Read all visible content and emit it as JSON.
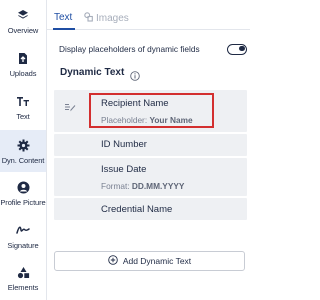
{
  "sidebar": {
    "items": [
      {
        "label": "Overview",
        "icon": "layers-icon"
      },
      {
        "label": "Uploads",
        "icon": "upload-icon"
      },
      {
        "label": "Text",
        "icon": "text-icon"
      },
      {
        "label": "Dyn. Content",
        "icon": "gear-icon",
        "active": true
      },
      {
        "label": "Profile Picture",
        "icon": "profile-icon"
      },
      {
        "label": "Signature",
        "icon": "signature-icon"
      },
      {
        "label": "Elements",
        "icon": "shapes-icon"
      }
    ]
  },
  "tabs": [
    {
      "label": "Text",
      "active": true
    },
    {
      "label": "Images",
      "active": false,
      "icon": "images-icon"
    }
  ],
  "settings": {
    "placeholder_toggle_label": "Display placeholders of dynamic fields",
    "placeholder_toggle_on": true
  },
  "dynamic_text": {
    "title": "Dynamic Text",
    "fields": [
      {
        "name": "Recipient Name",
        "sub_prefix": "Placeholder: ",
        "sub_value": "Your Name",
        "highlighted": true
      },
      {
        "name": "ID Number"
      },
      {
        "name": "Issue Date",
        "sub_prefix": "Format: ",
        "sub_value": "DD.MM.YYYY"
      },
      {
        "name": "Credential Name"
      }
    ],
    "add_button_label": "Add Dynamic Text"
  },
  "colors": {
    "accent": "#1f4ea3",
    "text": "#1f2a44",
    "active_nav_bg": "#e6ecf7",
    "field_bg": "#eef0f3",
    "highlight_border": "#d32f2f"
  }
}
